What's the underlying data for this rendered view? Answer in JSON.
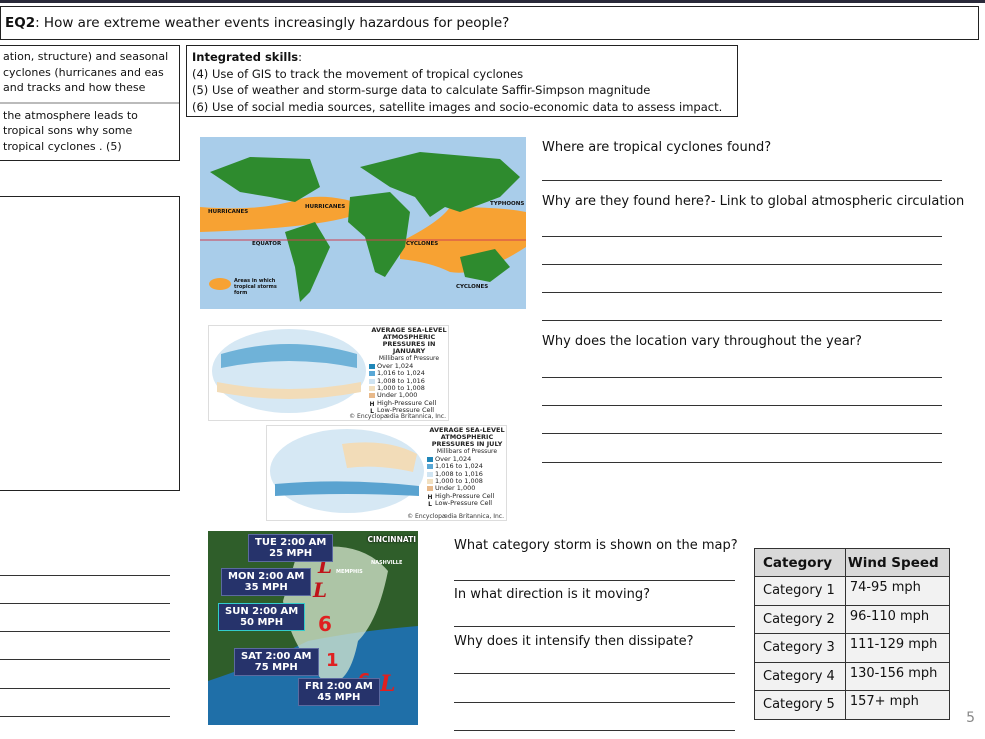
{
  "header": {
    "label": "EQ2",
    "question": ": How are extreme weather events increasingly hazardous for people?"
  },
  "left_box": {
    "para1": "ation, structure) and seasonal cyclones (hurricanes and eas and tracks and how these",
    "para2": "the atmosphere leads to tropical sons why some tropical cyclones . (5)"
  },
  "skills": {
    "title": "Integrated skills",
    "items": [
      "(4) Use of GIS to track the movement of tropical cyclones",
      "(5) Use of weather and storm-surge data to calculate Saffir-Simpson magnitude",
      "(6) Use of social media sources, satellite images and socio-economic data to assess impact."
    ]
  },
  "world_map": {
    "labels": [
      "HURRICANES",
      "HURRICANES",
      "TYPHOONS",
      "EQUATOR",
      "CYCLONES",
      "CYCLONES"
    ],
    "legend": "Areas in which tropical storms form",
    "colors": {
      "ocean": "#a9cdea",
      "land": "#2e8b2e",
      "storm_zone": "#f7a233"
    }
  },
  "pressure_maps": [
    {
      "title": "AVERAGE SEA-LEVEL ATMOSPHERIC PRESSURES IN JANUARY",
      "subtitle": "Millibars of Pressure",
      "legend": [
        "Over 1,024",
        "1,016 to 1,024",
        "1,008 to 1,016",
        "1,000 to 1,008",
        "Under 1,000",
        "High-Pressure Cell",
        "Low-Pressure Cell"
      ],
      "credit": "© Encyclopædia Britannica, Inc."
    },
    {
      "title": "AVERAGE SEA-LEVEL ATMOSPHERIC PRESSURES IN JULY",
      "subtitle": "Millibars of Pressure",
      "legend": [
        "Over 1,024",
        "1,016 to 1,024",
        "1,008 to 1,016",
        "1,000 to 1,008",
        "Under 1,000",
        "High-Pressure Cell",
        "Low-Pressure Cell"
      ],
      "credit": "© Encyclopædia Britannica, Inc."
    }
  ],
  "questions_top": [
    "Where are tropical cyclones found?",
    "Why are they found here?- Link to global atmospheric circulation",
    "Why does the location vary throughout the year?"
  ],
  "storm_map": {
    "track": [
      {
        "time": "TUE 2:00 AM",
        "speed": "25 MPH"
      },
      {
        "time": "MON 2:00 AM",
        "speed": "35 MPH"
      },
      {
        "time": "SUN 2:00 AM",
        "speed": "50 MPH"
      },
      {
        "time": "SAT 2:00 AM",
        "speed": "75 MPH"
      },
      {
        "time": "FRI 2:00 AM",
        "speed": "45 MPH"
      }
    ],
    "cities": [
      "MEMPHIS",
      "NASHVILLE",
      "CINCINNATI"
    ]
  },
  "questions_bottom": [
    "What category storm is shown on the map?",
    "In what direction is it moving?",
    "Why does it intensify then dissipate?"
  ],
  "table": {
    "headers": [
      "Category",
      "Wind Speed"
    ],
    "rows": [
      [
        "Category 1",
        "74-95 mph"
      ],
      [
        "Category 2",
        "96-110 mph"
      ],
      [
        "Category 3",
        "111-129 mph"
      ],
      [
        "Category 4",
        "130-156 mph"
      ],
      [
        "Category 5",
        "157+ mph"
      ]
    ]
  },
  "page_number": "5"
}
